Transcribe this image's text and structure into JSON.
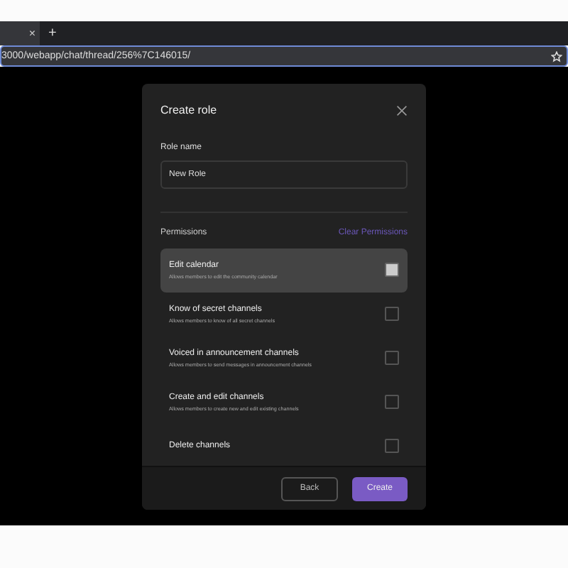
{
  "browser": {
    "tab": {
      "close": "×"
    },
    "new_tab": "+",
    "url": "3000/webapp/chat/thread/256%7C146015/"
  },
  "dialog": {
    "title": "Create role",
    "field": {
      "label": "Role name",
      "value": "New Role"
    },
    "permissions": {
      "label": "Permissions",
      "clear_link": "Clear Permissions",
      "items": [
        {
          "name": "Edit calendar",
          "description": "Allows members to edit the community calendar",
          "highlighted": true,
          "checked": false
        },
        {
          "name": "Know of secret channels",
          "description": "Allows members to know of all secret channels",
          "highlighted": false,
          "checked": false
        },
        {
          "name": "Voiced in announcement channels",
          "description": "Allows members to send messages in announcement channels",
          "highlighted": false,
          "checked": false
        },
        {
          "name": "Create and edit channels",
          "description": "Allows members to create new and edit existing channels",
          "highlighted": false,
          "checked": false
        },
        {
          "name": "Delete channels",
          "highlighted": false,
          "checked": false
        }
      ]
    },
    "buttons": [
      {
        "label": "Back",
        "kind": "secondary"
      },
      {
        "label": "Create",
        "kind": "primary"
      }
    ]
  }
}
